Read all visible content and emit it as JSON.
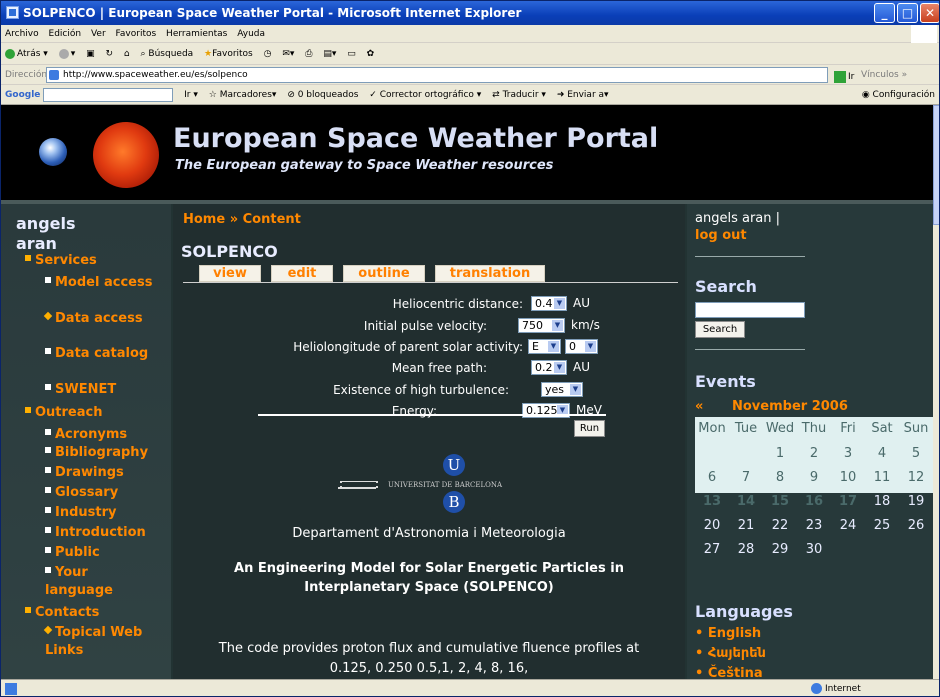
{
  "window": {
    "title": "SOLPENCO | European Space Weather Portal - Microsoft Internet Explorer"
  },
  "menu": [
    "Archivo",
    "Edición",
    "Ver",
    "Favoritos",
    "Herramientas",
    "Ayuda"
  ],
  "toolbar": {
    "back": "Atrás",
    "search": "Búsqueda",
    "favorites": "Favoritos"
  },
  "address": {
    "label": "Dirección",
    "url": "http://www.spaceweather.eu/es/solpenco",
    "go": "Ir",
    "links": "Vínculos"
  },
  "googlebar": {
    "label": "Google",
    "go": "Ir",
    "bookmarks": "Marcadores",
    "blocked": "0 bloqueados",
    "spell": "Corrector ortográfico",
    "translate": "Traducir",
    "send": "Enviar a",
    "config": "Configuración"
  },
  "site": {
    "title": "European Space Weather Portal",
    "subtitle": "The European gateway to Space Weather resources"
  },
  "left": {
    "user": "angels aran",
    "nav": [
      {
        "label": "Services",
        "level": 0,
        "bullet": "square"
      },
      {
        "label": "Model access",
        "level": 1,
        "bullet": "square"
      },
      {
        "label": "Data access",
        "level": 1,
        "bullet": "diamond"
      },
      {
        "label": "Data catalog",
        "level": 1,
        "bullet": "square"
      },
      {
        "label": "SWENET",
        "level": 1,
        "bullet": "square"
      },
      {
        "label": "Outreach",
        "level": 0,
        "bullet": "square"
      },
      {
        "label": "Acronyms",
        "level": 1,
        "bullet": "square"
      },
      {
        "label": "Bibliography",
        "level": 1,
        "bullet": "square"
      },
      {
        "label": "Drawings",
        "level": 1,
        "bullet": "square"
      },
      {
        "label": "Glossary",
        "level": 1,
        "bullet": "square"
      },
      {
        "label": "Industry",
        "level": 1,
        "bullet": "square"
      },
      {
        "label": "Introduction",
        "level": 1,
        "bullet": "square"
      },
      {
        "label": "Public",
        "level": 1,
        "bullet": "square"
      },
      {
        "label": "Your language",
        "level": 1,
        "bullet": "square"
      },
      {
        "label": "Contacts",
        "level": 0,
        "bullet": "square"
      },
      {
        "label": "Topical Web Links",
        "level": 1,
        "bullet": "diamond"
      }
    ]
  },
  "center": {
    "breadcrumb": "Home » Content",
    "title": "SOLPENCO",
    "tabs": [
      "view",
      "edit",
      "outline",
      "translation"
    ],
    "form": [
      {
        "label": "Heliocentric distance:",
        "value": "0.4",
        "unit": "AU"
      },
      {
        "label": "Initial pulse velocity:",
        "value": "750",
        "unit": "km/s"
      },
      {
        "label": "Heliolongitude of parent solar activity:",
        "value": "E",
        "value2": "0"
      },
      {
        "label": "Mean free path:",
        "value": "0.2",
        "unit": "AU"
      },
      {
        "label": "Existence of high turbulence:",
        "value": "yes"
      },
      {
        "label": "Energy:",
        "value": "0.125",
        "unit": "MeV"
      }
    ],
    "run": "Run",
    "logo": {
      "u": "U",
      "b": "B",
      "text": "UNIVERSITAT DE BARCELONA"
    },
    "dept": "Departament d'Astronomia i Meteorologia",
    "paper_title": "An Engineering Model for Solar Energetic Particles in Interplanetary Space (SOLPENCO)",
    "desc": "The code provides proton flux and cumulative fluence profiles at 0.125, 0.250 0.5,1, 2, 4, 8, 16,"
  },
  "right": {
    "user": "angels aran |",
    "logout": "log out",
    "search_heading": "Search",
    "search_btn": "Search",
    "events_heading": "Events",
    "cal_prev": "«",
    "cal_month": "November 2006",
    "days": [
      "Mon",
      "Tue",
      "Wed",
      "Thu",
      "Fri",
      "Sat",
      "Sun"
    ],
    "weeks": [
      [
        "",
        "",
        "1",
        "2",
        "3",
        "4",
        "5"
      ],
      [
        "6",
        "7",
        "8",
        "9",
        "10",
        "11",
        "12"
      ],
      [
        "13",
        "14",
        "15",
        "16",
        "17",
        "18",
        "19"
      ],
      [
        "20",
        "21",
        "22",
        "23",
        "24",
        "25",
        "26"
      ],
      [
        "27",
        "28",
        "29",
        "30",
        "",
        "",
        ""
      ]
    ],
    "highlighted": [
      "13",
      "14",
      "15",
      "16",
      "17"
    ],
    "languages_heading": "Languages",
    "languages": [
      "English",
      "Հայերեն",
      "Čeština"
    ]
  },
  "status": {
    "zone": "Internet"
  }
}
